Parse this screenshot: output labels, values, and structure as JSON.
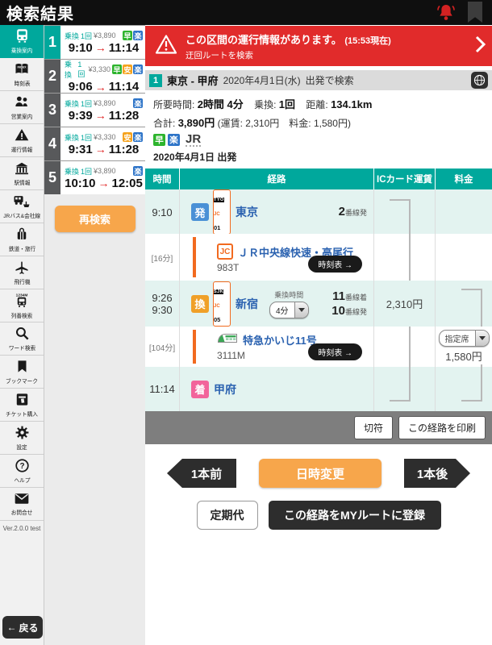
{
  "colors": {
    "accent_teal": "#00a89c",
    "alert_red": "#e12b2b",
    "action_orange": "#f7a64b",
    "badge_early_green": "#2db42d",
    "badge_cheap_orange": "#f5a31e",
    "badge_easy_blue": "#2d74c8",
    "depart_blue": "#4a90d6",
    "transfer_orange": "#f0a028",
    "arrive_pink": "#f2649b",
    "line_orange": "#f26a1f",
    "station_link_blue": "#2b62b0",
    "dark_button": "#2d2d2d"
  },
  "glyphs": {
    "route_arrow": "→",
    "back_arrow": "←"
  },
  "header": {
    "title": "検索結果"
  },
  "sidebar": {
    "items": [
      {
        "icon": "train-icon",
        "label": "乗換案内",
        "active": true
      },
      {
        "icon": "timetable-book-icon",
        "label": "時刻表"
      },
      {
        "icon": "staff-icon",
        "label": "営業案内"
      },
      {
        "icon": "warning-triangle-icon",
        "label": "運行情報"
      },
      {
        "icon": "station-building-icon",
        "label": "駅情報"
      },
      {
        "icon": "bus-ship-icon",
        "label": "JRバス&会社線"
      },
      {
        "icon": "travel-bag-icon",
        "label": "鉄道・旅行"
      },
      {
        "icon": "airplane-icon",
        "label": "飛行機"
      },
      {
        "icon": "train-number-icon",
        "label": "列番検索",
        "icon_text": "1234M"
      },
      {
        "icon": "search-icon",
        "label": "ワード検索"
      },
      {
        "icon": "bookmark-icon",
        "label": "ブックマーク"
      },
      {
        "icon": "ticket-icon",
        "label": "チケット購入"
      },
      {
        "icon": "gear-icon",
        "label": "設定"
      },
      {
        "icon": "help-icon",
        "label": "ヘルプ"
      },
      {
        "icon": "mail-icon",
        "label": "お問合せ"
      }
    ],
    "version": "Ver.2.0.0 test",
    "back_label": "戻る"
  },
  "route_options": {
    "items": [
      {
        "num": "1",
        "transfer_label": "乗換",
        "transfer_count": "1回",
        "price": "¥3,890",
        "badges": [
          "早",
          "楽"
        ],
        "depart": "9:10",
        "arrive": "11:14",
        "selected": true
      },
      {
        "num": "2",
        "transfer_label": "乗換",
        "transfer_count": "1回",
        "price": "¥3,330",
        "badges": [
          "早",
          "安",
          "楽"
        ],
        "depart": "9:06",
        "arrive": "11:14",
        "selected": false
      },
      {
        "num": "3",
        "transfer_label": "乗換",
        "transfer_count": "1回",
        "price": "¥3,890",
        "badges": [
          "楽"
        ],
        "depart": "9:39",
        "arrive": "11:28",
        "selected": false
      },
      {
        "num": "4",
        "transfer_label": "乗換",
        "transfer_count": "1回",
        "price": "¥3,330",
        "badges": [
          "安",
          "楽"
        ],
        "depart": "9:31",
        "arrive": "11:28",
        "selected": false
      },
      {
        "num": "5",
        "transfer_label": "乗換",
        "transfer_count": "1回",
        "price": "¥3,890",
        "badges": [
          "楽"
        ],
        "depart": "10:10",
        "arrive": "12:05",
        "selected": false
      }
    ],
    "research_label": "再検索"
  },
  "alert": {
    "message": "この区間の運行情報があります。",
    "time_note": "(15:53現在)",
    "sub": "迂回ルートを検索"
  },
  "info_bar": {
    "num": "1",
    "route": "東京 - 甲府",
    "date": "2020年4月1日(水)",
    "search_mode": "出発で検索"
  },
  "summary": {
    "stats": [
      {
        "label": "所要時間:",
        "value": "2時間 4分"
      },
      {
        "label": "乗換:",
        "value": "1回"
      },
      {
        "label": "距離:",
        "value": "134.1km"
      }
    ],
    "total": {
      "label": "合計:",
      "value": "3,890円",
      "detail": "(運賃: 2,310円　料金: 1,580円)"
    },
    "badges": [
      "早",
      "楽"
    ],
    "jr_mark": "JR",
    "date_line": "2020年4月1日 出発"
  },
  "table": {
    "headers": [
      "時間",
      "経路",
      "ICカード運賃",
      "料金"
    ],
    "depart_row": {
      "time": "9:10",
      "badge": "発",
      "station_code_top": "TYO",
      "station_code_line": "JC",
      "station_code_num": "01",
      "station": "東京",
      "platform": "2",
      "platform_suffix": "番線発"
    },
    "segment1": {
      "duration": "[16分]",
      "line_badge": "JC",
      "train": "ＪＲ中央線快速・高尾行",
      "train_no": "983T",
      "timetable_label": "時刻表 →"
    },
    "transfer_row": {
      "time_arrive": "9:26",
      "time_depart": "9:30",
      "badge": "換",
      "station_code_top": "SJK",
      "station_code_line": "JC",
      "station_code_num": "05",
      "station": "新宿",
      "transfer_time_label": "乗換時間",
      "transfer_time_value": "4分",
      "arrive_platform": "11",
      "arrive_suffix": "番線着",
      "depart_platform": "10",
      "depart_suffix": "番線発",
      "ic_fare": "2,310円"
    },
    "segment2": {
      "duration": "[104分]",
      "train": "特急かいじ11号",
      "train_no": "3111M",
      "timetable_label": "時刻表 →",
      "seat_type": "指定席",
      "fare": "1,580円"
    },
    "arrive_row": {
      "time": "11:14",
      "badge": "着",
      "station": "甲府"
    },
    "actions": [
      "切符",
      "この経路を印刷"
    ]
  },
  "nav": {
    "prev": "1本前",
    "datetime_change": "日時変更",
    "next": "1本後",
    "commuter_pass": "定期代",
    "register_myroute": "この経路をMYルートに登録"
  }
}
